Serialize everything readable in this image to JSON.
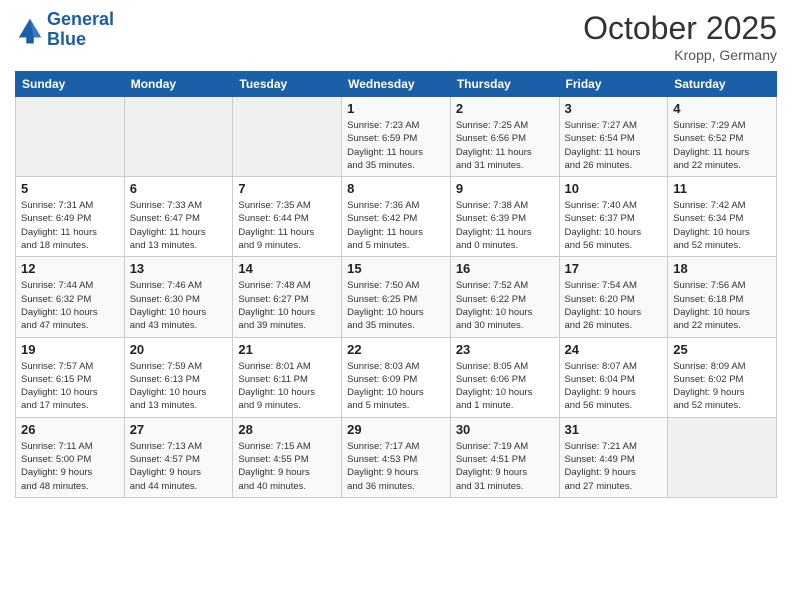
{
  "header": {
    "logo_line1": "General",
    "logo_line2": "Blue",
    "month": "October 2025",
    "location": "Kropp, Germany"
  },
  "weekdays": [
    "Sunday",
    "Monday",
    "Tuesday",
    "Wednesday",
    "Thursday",
    "Friday",
    "Saturday"
  ],
  "weeks": [
    [
      {
        "day": "",
        "info": ""
      },
      {
        "day": "",
        "info": ""
      },
      {
        "day": "",
        "info": ""
      },
      {
        "day": "1",
        "info": "Sunrise: 7:23 AM\nSunset: 6:59 PM\nDaylight: 11 hours\nand 35 minutes."
      },
      {
        "day": "2",
        "info": "Sunrise: 7:25 AM\nSunset: 6:56 PM\nDaylight: 11 hours\nand 31 minutes."
      },
      {
        "day": "3",
        "info": "Sunrise: 7:27 AM\nSunset: 6:54 PM\nDaylight: 11 hours\nand 26 minutes."
      },
      {
        "day": "4",
        "info": "Sunrise: 7:29 AM\nSunset: 6:52 PM\nDaylight: 11 hours\nand 22 minutes."
      }
    ],
    [
      {
        "day": "5",
        "info": "Sunrise: 7:31 AM\nSunset: 6:49 PM\nDaylight: 11 hours\nand 18 minutes."
      },
      {
        "day": "6",
        "info": "Sunrise: 7:33 AM\nSunset: 6:47 PM\nDaylight: 11 hours\nand 13 minutes."
      },
      {
        "day": "7",
        "info": "Sunrise: 7:35 AM\nSunset: 6:44 PM\nDaylight: 11 hours\nand 9 minutes."
      },
      {
        "day": "8",
        "info": "Sunrise: 7:36 AM\nSunset: 6:42 PM\nDaylight: 11 hours\nand 5 minutes."
      },
      {
        "day": "9",
        "info": "Sunrise: 7:38 AM\nSunset: 6:39 PM\nDaylight: 11 hours\nand 0 minutes."
      },
      {
        "day": "10",
        "info": "Sunrise: 7:40 AM\nSunset: 6:37 PM\nDaylight: 10 hours\nand 56 minutes."
      },
      {
        "day": "11",
        "info": "Sunrise: 7:42 AM\nSunset: 6:34 PM\nDaylight: 10 hours\nand 52 minutes."
      }
    ],
    [
      {
        "day": "12",
        "info": "Sunrise: 7:44 AM\nSunset: 6:32 PM\nDaylight: 10 hours\nand 47 minutes."
      },
      {
        "day": "13",
        "info": "Sunrise: 7:46 AM\nSunset: 6:30 PM\nDaylight: 10 hours\nand 43 minutes."
      },
      {
        "day": "14",
        "info": "Sunrise: 7:48 AM\nSunset: 6:27 PM\nDaylight: 10 hours\nand 39 minutes."
      },
      {
        "day": "15",
        "info": "Sunrise: 7:50 AM\nSunset: 6:25 PM\nDaylight: 10 hours\nand 35 minutes."
      },
      {
        "day": "16",
        "info": "Sunrise: 7:52 AM\nSunset: 6:22 PM\nDaylight: 10 hours\nand 30 minutes."
      },
      {
        "day": "17",
        "info": "Sunrise: 7:54 AM\nSunset: 6:20 PM\nDaylight: 10 hours\nand 26 minutes."
      },
      {
        "day": "18",
        "info": "Sunrise: 7:56 AM\nSunset: 6:18 PM\nDaylight: 10 hours\nand 22 minutes."
      }
    ],
    [
      {
        "day": "19",
        "info": "Sunrise: 7:57 AM\nSunset: 6:15 PM\nDaylight: 10 hours\nand 17 minutes."
      },
      {
        "day": "20",
        "info": "Sunrise: 7:59 AM\nSunset: 6:13 PM\nDaylight: 10 hours\nand 13 minutes."
      },
      {
        "day": "21",
        "info": "Sunrise: 8:01 AM\nSunset: 6:11 PM\nDaylight: 10 hours\nand 9 minutes."
      },
      {
        "day": "22",
        "info": "Sunrise: 8:03 AM\nSunset: 6:09 PM\nDaylight: 10 hours\nand 5 minutes."
      },
      {
        "day": "23",
        "info": "Sunrise: 8:05 AM\nSunset: 6:06 PM\nDaylight: 10 hours\nand 1 minute."
      },
      {
        "day": "24",
        "info": "Sunrise: 8:07 AM\nSunset: 6:04 PM\nDaylight: 9 hours\nand 56 minutes."
      },
      {
        "day": "25",
        "info": "Sunrise: 8:09 AM\nSunset: 6:02 PM\nDaylight: 9 hours\nand 52 minutes."
      }
    ],
    [
      {
        "day": "26",
        "info": "Sunrise: 7:11 AM\nSunset: 5:00 PM\nDaylight: 9 hours\nand 48 minutes."
      },
      {
        "day": "27",
        "info": "Sunrise: 7:13 AM\nSunset: 4:57 PM\nDaylight: 9 hours\nand 44 minutes."
      },
      {
        "day": "28",
        "info": "Sunrise: 7:15 AM\nSunset: 4:55 PM\nDaylight: 9 hours\nand 40 minutes."
      },
      {
        "day": "29",
        "info": "Sunrise: 7:17 AM\nSunset: 4:53 PM\nDaylight: 9 hours\nand 36 minutes."
      },
      {
        "day": "30",
        "info": "Sunrise: 7:19 AM\nSunset: 4:51 PM\nDaylight: 9 hours\nand 31 minutes."
      },
      {
        "day": "31",
        "info": "Sunrise: 7:21 AM\nSunset: 4:49 PM\nDaylight: 9 hours\nand 27 minutes."
      },
      {
        "day": "",
        "info": ""
      }
    ]
  ]
}
